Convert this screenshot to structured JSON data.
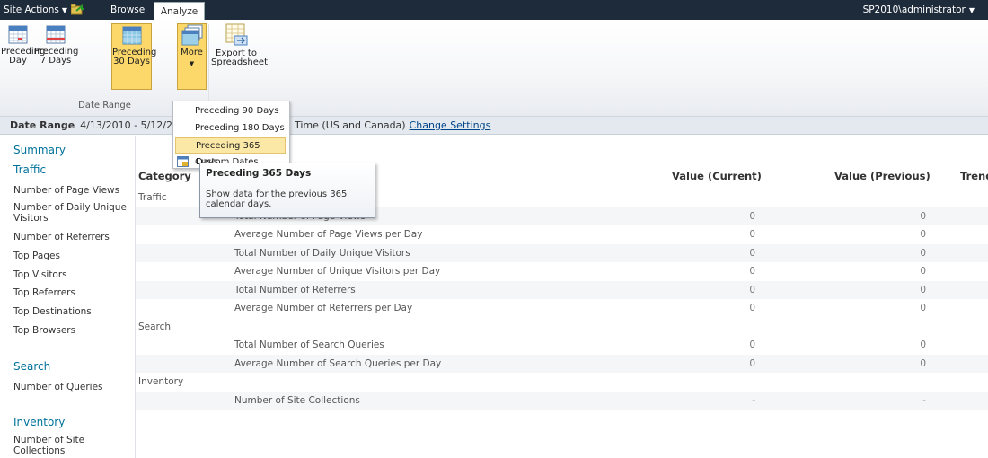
{
  "topbar": {
    "site_actions": "Site Actions",
    "tab_browse": "Browse",
    "tab_analyze": "Analyze",
    "user": "SP2010\\administrator"
  },
  "ribbon": {
    "buttons": [
      {
        "label": "Preceding Day",
        "icon": "calendar-day-icon"
      },
      {
        "label": "Preceding 7 Days",
        "icon": "calendar-week-icon"
      },
      {
        "label": "Preceding 30 Days",
        "icon": "calendar-month-icon"
      },
      {
        "label": "More",
        "icon": "calendar-stack-icon"
      },
      {
        "label": "Export to Spreadsheet",
        "icon": "export-spreadsheet-icon"
      }
    ],
    "group_label": "Date Range"
  },
  "date_range": {
    "label": "Date Range",
    "value": "4/13/2010 - 5/12/2",
    "timezone_suffix": "Time (US and Canada)",
    "change_settings": "Change Settings"
  },
  "more_menu": {
    "items": [
      "Preceding 90 Days",
      "Preceding 180 Days",
      "Preceding 365 Days",
      "Custom Dates"
    ],
    "highlighted": "Preceding 365 Days"
  },
  "tooltip": {
    "title": "Preceding 365 Days",
    "body": "Show data for the previous 365 calendar days."
  },
  "left_nav": {
    "summary": "Summary",
    "traffic": "Traffic",
    "traffic_items": [
      "Number of Page Views",
      "Number of Daily Unique Visitors",
      "Number of Referrers",
      "Top Pages",
      "Top Visitors",
      "Top Referrers",
      "Top Destinations",
      "Top Browsers"
    ],
    "search": "Search",
    "search_items": [
      "Number of Queries"
    ],
    "inventory": "Inventory",
    "inventory_items": [
      "Number of Site Collections"
    ]
  },
  "table": {
    "headers": {
      "category": "Category",
      "value_current": "Value (Current)",
      "value_previous": "Value (Previous)",
      "trend": "Trend"
    },
    "rows": [
      {
        "category": "Traffic",
        "metric": "",
        "current": "",
        "previous": ""
      },
      {
        "category": "",
        "metric": "Total Number of Page Views",
        "current": "0",
        "previous": "0"
      },
      {
        "category": "",
        "metric": "Average Number of Page Views per Day",
        "current": "0",
        "previous": "0"
      },
      {
        "category": "",
        "metric": "Total Number of Daily Unique Visitors",
        "current": "0",
        "previous": "0"
      },
      {
        "category": "",
        "metric": "Average Number of Unique Visitors per Day",
        "current": "0",
        "previous": "0"
      },
      {
        "category": "",
        "metric": "Total Number of Referrers",
        "current": "0",
        "previous": "0"
      },
      {
        "category": "",
        "metric": "Average Number of Referrers per Day",
        "current": "0",
        "previous": "0"
      },
      {
        "category": "Search",
        "metric": "",
        "current": "",
        "previous": ""
      },
      {
        "category": "",
        "metric": "Total Number of Search Queries",
        "current": "0",
        "previous": "0"
      },
      {
        "category": "",
        "metric": "Average Number of Search Queries per Day",
        "current": "0",
        "previous": "0"
      },
      {
        "category": "Inventory",
        "metric": "",
        "current": "",
        "previous": ""
      },
      {
        "category": "",
        "metric": "Number of Site Collections",
        "current": "-",
        "previous": "-"
      }
    ]
  }
}
